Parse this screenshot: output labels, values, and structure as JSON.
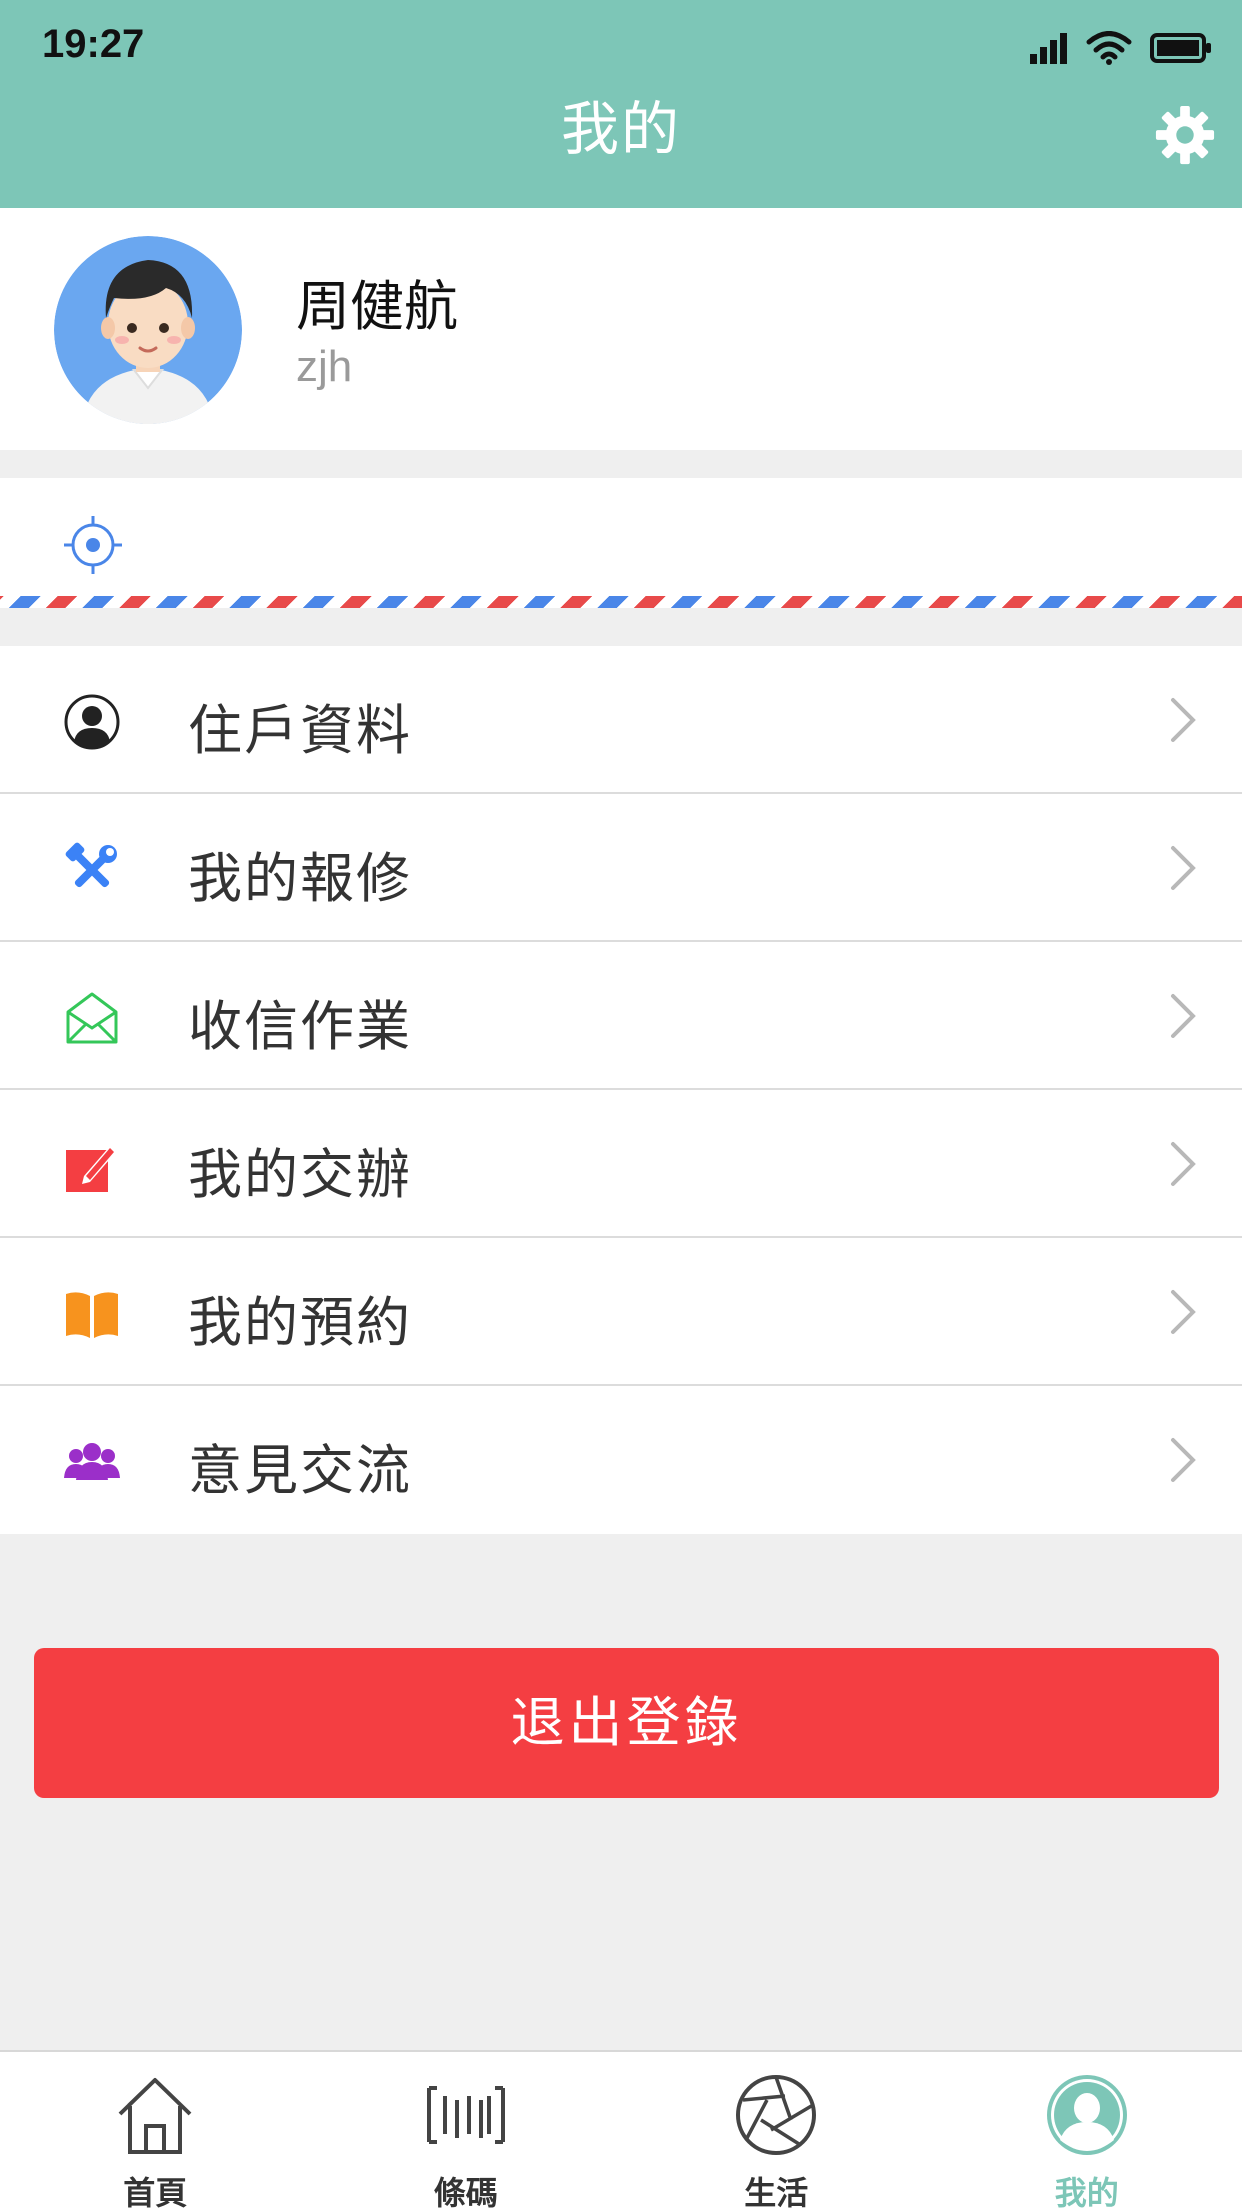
{
  "status_bar": {
    "time": "19:27"
  },
  "header": {
    "title": "我的"
  },
  "profile": {
    "name": "周健航",
    "username": "zjh"
  },
  "menu": [
    {
      "label": "住戶資料",
      "icon": "person-circle-icon",
      "color": "#222222"
    },
    {
      "label": "我的報修",
      "icon": "tools-icon",
      "color": "#3b82f6"
    },
    {
      "label": "收信作業",
      "icon": "mail-open-icon",
      "color": "#34c759"
    },
    {
      "label": "我的交辦",
      "icon": "edit-note-icon",
      "color": "#f43e42"
    },
    {
      "label": "我的預約",
      "icon": "open-book-icon",
      "color": "#f7931e"
    },
    {
      "label": "意見交流",
      "icon": "group-icon",
      "color": "#9b2fc9"
    }
  ],
  "logout": {
    "label": "退出登錄",
    "color": "#f43e42"
  },
  "tabbar": [
    {
      "label": "首頁",
      "icon": "home-icon",
      "active": false
    },
    {
      "label": "條碼",
      "icon": "barcode-icon",
      "active": false
    },
    {
      "label": "生活",
      "icon": "aperture-icon",
      "active": false
    },
    {
      "label": "我的",
      "icon": "profile-icon",
      "active": true
    }
  ],
  "colors": {
    "header": "#7dc6b7",
    "accent": "#7dc6b7",
    "danger": "#f43e42"
  }
}
